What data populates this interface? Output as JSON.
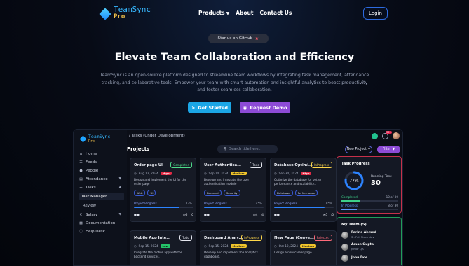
{
  "brand": {
    "name": "TeamSync",
    "edition": "Pro"
  },
  "nav": {
    "products": "Products",
    "about": "About",
    "contact": "Contact Us",
    "login": "Login"
  },
  "hero": {
    "github_pill": "Star us on GitHub",
    "title": "Elevate Team Collaboration and Efficiency",
    "description": "TeamSync is an open-source platform designed to streamline team workflows by integrating task management, attendance tracking, and collaborative tools. Empower your team with smart automation and insightful analytics to boost productivity and foster seamless collaboration.",
    "cta_primary": "Get Started",
    "cta_secondary": "Request Demo"
  },
  "app": {
    "breadcrumb": "/ Tasks (Under Development)",
    "notification_count": "99+",
    "sidebar": {
      "items": [
        {
          "label": "Home",
          "icon": "home-icon"
        },
        {
          "label": "Feeds",
          "icon": "feeds-icon"
        },
        {
          "label": "People",
          "icon": "people-icon"
        },
        {
          "label": "Attendance",
          "icon": "attendance-icon"
        },
        {
          "label": "Tasks",
          "icon": "tasks-icon"
        }
      ],
      "sub_items": [
        "Task Manager",
        "Review"
      ],
      "bottom_items": [
        {
          "label": "Salary",
          "icon": "salary-icon"
        },
        {
          "label": "Documentation",
          "icon": "documentation-icon"
        },
        {
          "label": "Help Desk",
          "icon": "help-icon"
        }
      ]
    },
    "projects_title": "Projects",
    "search_placeholder": "Search title here...",
    "new_project": "New Project +",
    "filter": "Filter",
    "cards": [
      {
        "title": "Order page UI",
        "status": "Completed",
        "date": "Aug 12, 2024",
        "priority": "High",
        "desc": "Design and implement the UI for the order page",
        "tags": [
          "Web",
          "UI"
        ],
        "progress_label": "Project Progress",
        "progress": 77,
        "progress_text": "77%",
        "comments": "6",
        "files": "0"
      },
      {
        "title": "User Authentica...",
        "status": "Todo",
        "date": "Sep 10, 2024",
        "priority": "Medium",
        "desc": "Develop and integrate the user authentication module",
        "tags": [
          "Backend",
          "Security"
        ],
        "progress_label": "Project Progress",
        "progress": 45,
        "progress_text": "45%",
        "comments": "4",
        "files": "4"
      },
      {
        "title": "Database Optimi...",
        "status": "InProgress",
        "date": "Sep 30, 2024",
        "priority": "High",
        "desc": "Optimize the database for better performance and scalability...",
        "tags": [
          "Database",
          "Performance"
        ],
        "progress_label": "Project Progress",
        "progress": 85,
        "progress_text": "85%",
        "comments": "5",
        "files": "5"
      },
      {
        "title": "Mobile App Inte...",
        "status": "Todo",
        "date": "Sep 15, 2024",
        "priority": "Low",
        "desc": "Integrate the mobile app with the backend services.",
        "tags": [],
        "progress_label": "",
        "progress": null,
        "progress_text": "",
        "comments": "",
        "files": ""
      },
      {
        "title": "Dashboard Analy...",
        "status": "InProgress",
        "date": "Sep 15, 2024",
        "priority": "Medium",
        "desc": "Develop and implement the analytics dashboard.",
        "tags": [],
        "progress_label": "",
        "progress": null,
        "progress_text": "",
        "comments": "",
        "files": ""
      },
      {
        "title": "New Page (Conve...",
        "status": "Rejected",
        "date": "Oct 10, 2024",
        "priority": "Medium",
        "desc": "Design a new career page",
        "tags": [],
        "progress_label": "",
        "progress": null,
        "progress_text": "",
        "comments": "",
        "files": ""
      }
    ],
    "task_progress": {
      "title": "Task Progress",
      "percent": 77,
      "percent_text": "77%",
      "running_label": "Running Task",
      "running_value": "30",
      "completed_label": "Completed",
      "completed_value": "10 of 30",
      "inprogress_label": "In Progress",
      "inprogress_value": "8 of 30"
    },
    "team": {
      "title": "My Team (5)",
      "members": [
        {
          "name": "Farine Ahmed",
          "role": "Sr. Full Stack dev"
        },
        {
          "name": "Aman Gupta",
          "role": "Junior QA"
        },
        {
          "name": "John Doe",
          "role": ""
        }
      ]
    }
  },
  "colors": {
    "accent": "#1ba6e6",
    "purple": "#8d4bd6",
    "brand_blue": "#37b8ff",
    "pro_gold": "#f0c14b"
  }
}
